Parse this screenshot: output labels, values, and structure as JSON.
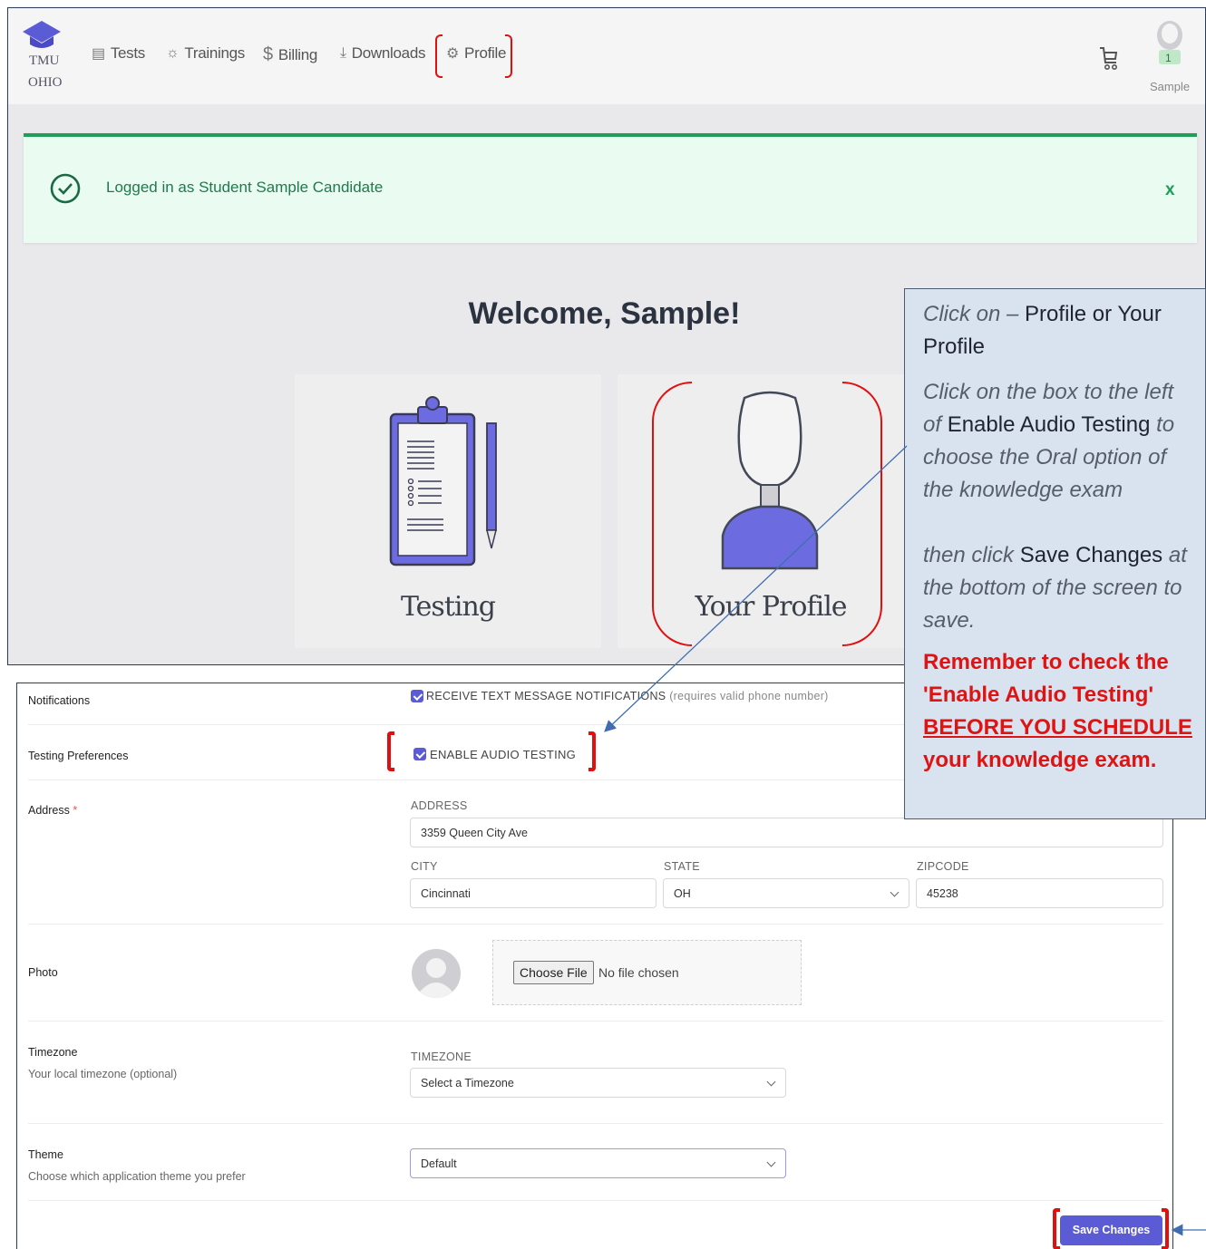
{
  "navbar": {
    "logo_line1": "TMU",
    "logo_line2": "OHIO",
    "items": [
      {
        "label": "Tests",
        "icon": "clipboard-icon"
      },
      {
        "label": "Trainings",
        "icon": "lightbulb-icon"
      },
      {
        "label": "Billing",
        "icon": "dollar-icon"
      },
      {
        "label": "Downloads",
        "icon": "download-icon"
      },
      {
        "label": "Profile",
        "icon": "gear-icon"
      }
    ],
    "cart_icon": "cart-icon",
    "avatar_badge": "1",
    "user_name": "Sample"
  },
  "alert": {
    "message": "Logged in as Student Sample Candidate",
    "close": "x"
  },
  "welcome": "Welcome, Sample!",
  "cards": {
    "testing": "Testing",
    "profile": "Your Profile"
  },
  "callout": {
    "line1_italic": "Click on – ",
    "line1_bold": "Profile or Your Profile",
    "line2_italic_a": "Click on the box to the left of ",
    "line2_plain": "Enable Audio Testing",
    "line2_italic_b": " to choose the Oral option of the knowledge exam",
    "line3_italic_a": "then click ",
    "line3_plain": "Save Changes",
    "line3_italic_b": " at the bottom of the screen to save.",
    "warn_a": "Remember to check the 'Enable Audio Testing' ",
    "warn_u": "BEFORE YOU SCHEDULE",
    "warn_b": " your knowledge exam."
  },
  "form": {
    "notifications": {
      "label": "Notifications",
      "checkbox": "RECEIVE TEXT MESSAGE NOTIFICATIONS",
      "hint": " (requires valid phone number)"
    },
    "testing_prefs": {
      "label": "Testing Preferences",
      "checkbox": "ENABLE AUDIO TESTING"
    },
    "address": {
      "label": "Address",
      "required": "*",
      "address_cap": "ADDRESS",
      "address_val": "3359 Queen City Ave",
      "city_cap": "CITY",
      "city_val": "Cincinnati",
      "state_cap": "STATE",
      "state_val": "OH",
      "zip_cap": "ZIPCODE",
      "zip_val": "45238"
    },
    "photo": {
      "label": "Photo",
      "choose_btn": "Choose File",
      "no_file": "No file chosen"
    },
    "timezone": {
      "label": "Timezone",
      "sub": "Your local timezone (optional)",
      "cap": "TIMEZONE",
      "value": "Select a Timezone"
    },
    "theme": {
      "label": "Theme",
      "sub": "Choose which application theme you prefer",
      "value": "Default"
    },
    "save": "Save Changes"
  },
  "colors": {
    "accent": "#5b5bd6",
    "success": "#1e9e5a",
    "annotation_red": "#e01010",
    "callout_bg": "#d9e2ef"
  }
}
